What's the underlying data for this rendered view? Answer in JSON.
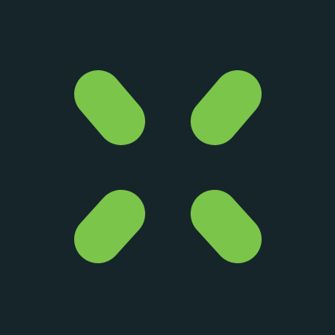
{
  "icon": {
    "name": "x-logo-icon",
    "shape": "four rounded diagonal bars forming an X",
    "colors": {
      "background": "#16252A",
      "accent": "#7BC54A"
    }
  }
}
